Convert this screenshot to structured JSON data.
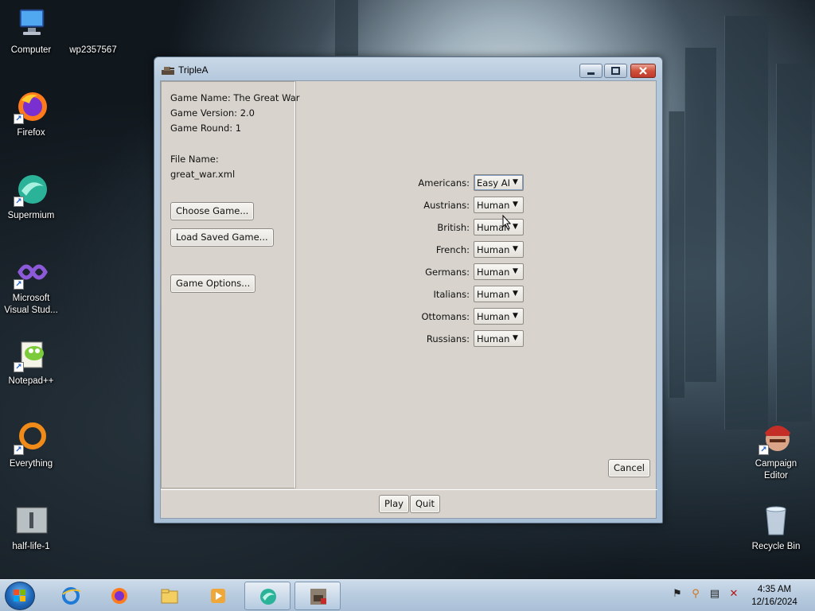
{
  "desktop": {
    "icons": [
      {
        "label": "Computer"
      },
      {
        "label": "wp2357567"
      },
      {
        "label": "Firefox"
      },
      {
        "label": "Supermium"
      },
      {
        "label": "Microsoft Visual Stud..."
      },
      {
        "label": "Notepad++"
      },
      {
        "label": "Everything"
      },
      {
        "label": "half-life-1"
      },
      {
        "label": "Campaign Editor"
      },
      {
        "label": "Recycle Bin"
      }
    ]
  },
  "window": {
    "title": "TripleA",
    "game_info": {
      "name_line": "Game Name:   The Great War",
      "version_line": "Game Version:  2.0",
      "round_line": "Game Round:   1",
      "file_label": "File Name:",
      "file_value": "great_war.xml"
    },
    "buttons": {
      "choose_game": "Choose Game...",
      "load_saved": "Load Saved Game...",
      "game_options": "Game Options...",
      "cancel": "Cancel",
      "play": "Play",
      "quit": "Quit"
    },
    "players": [
      {
        "label": "Americans:",
        "value": "Easy AI"
      },
      {
        "label": "Austrians:",
        "value": "Human"
      },
      {
        "label": "British:",
        "value": "Human"
      },
      {
        "label": "French:",
        "value": "Human"
      },
      {
        "label": "Germans:",
        "value": "Human"
      },
      {
        "label": "Italians:",
        "value": "Human"
      },
      {
        "label": "Ottomans:",
        "value": "Human"
      },
      {
        "label": "Russians:",
        "value": "Human"
      }
    ]
  },
  "taskbar": {
    "clock_time": "4:35 AM",
    "clock_date": "12/16/2024"
  },
  "colors": {
    "client_bg": "#d8d4cd",
    "title_gradient_top": "#c9d8e8",
    "close_red": "#c0392b"
  }
}
